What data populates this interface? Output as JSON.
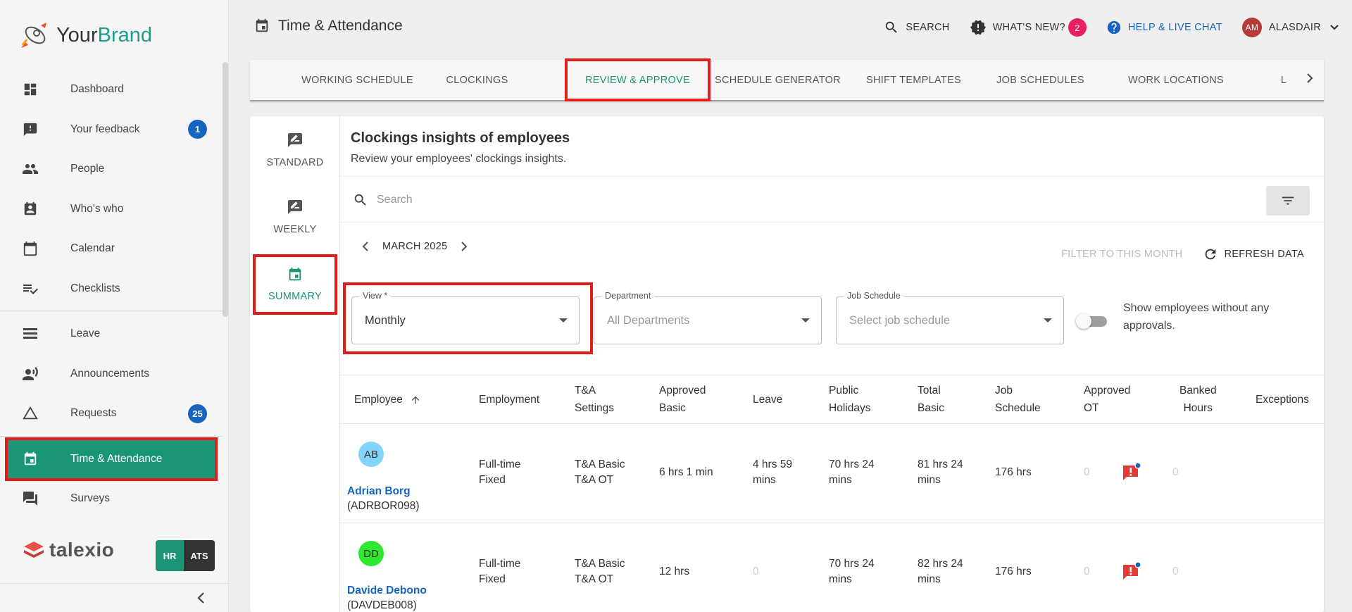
{
  "brand": {
    "name_part1": "Your",
    "name_part2": "Brand",
    "accent_color": "#1a9e8f"
  },
  "sidebar": {
    "items": [
      {
        "label": "Dashboard",
        "icon": "dashboard-icon"
      },
      {
        "label": "Your feedback",
        "icon": "feedback-icon",
        "badge": "1"
      },
      {
        "label": "People",
        "icon": "people-icon"
      },
      {
        "label": "Who's who",
        "icon": "contact-card-icon"
      },
      {
        "label": "Calendar",
        "icon": "calendar-icon"
      },
      {
        "label": "Checklists",
        "icon": "checklist-icon"
      },
      {
        "label": "Leave",
        "icon": "leave-icon"
      },
      {
        "label": "Announcements",
        "icon": "announcement-icon"
      },
      {
        "label": "Requests",
        "icon": "requests-icon",
        "badge": "25"
      },
      {
        "label": "Time & Attendance",
        "icon": "time-attendance-icon",
        "active": true
      },
      {
        "label": "Surveys",
        "icon": "surveys-icon"
      }
    ],
    "footer_logo": "talexio",
    "hr_label": "HR",
    "ats_label": "ATS"
  },
  "header": {
    "title": "Time & Attendance",
    "search_label": "SEARCH",
    "whats_new_label": "WHAT'S NEW?",
    "whats_new_count": "2",
    "help_label": "HELP & LIVE CHAT",
    "user_initials": "AM",
    "user_name": "ALASDAIR"
  },
  "tabs": [
    {
      "label": "WORKING SCHEDULE"
    },
    {
      "label": "CLOCKINGS"
    },
    {
      "label": "REVIEW & APPROVE",
      "active": true
    },
    {
      "label": "SCHEDULE GENERATOR"
    },
    {
      "label": "SHIFT TEMPLATES"
    },
    {
      "label": "JOB SCHEDULES"
    },
    {
      "label": "WORK LOCATIONS"
    },
    {
      "label": "L"
    }
  ],
  "view_tabs": [
    {
      "label": "STANDARD"
    },
    {
      "label": "WEEKLY"
    },
    {
      "label": "SUMMARY",
      "active": true
    }
  ],
  "main": {
    "title": "Clockings insights of employees",
    "subtitle": "Review your employees' clockings insights.",
    "search_placeholder": "Search",
    "month": "MARCH 2025",
    "filter_month_label": "FILTER TO THIS MONTH",
    "refresh_label": "REFRESH DATA",
    "fields": {
      "view": {
        "label": "View *",
        "value": "Monthly"
      },
      "department": {
        "label": "Department",
        "placeholder": "All Departments"
      },
      "job_schedule": {
        "label": "Job Schedule",
        "placeholder": "Select job schedule"
      }
    },
    "toggle_label": "Show employees without any approvals.",
    "table": {
      "headers": {
        "employee": "Employee",
        "employment": "Employment",
        "ta_settings_1": "T&A",
        "ta_settings_2": "Settings",
        "approved_basic_1": "Approved",
        "approved_basic_2": "Basic",
        "leave": "Leave",
        "public_holidays_1": "Public",
        "public_holidays_2": "Holidays",
        "total_basic_1": "Total",
        "total_basic_2": "Basic",
        "job_schedule_1": "Job",
        "job_schedule_2": "Schedule",
        "approved_ot_1": "Approved",
        "approved_ot_2": "OT",
        "banked_hours_1": "Banked",
        "banked_hours_2": "Hours",
        "exceptions": "Exceptions"
      },
      "rows": [
        {
          "initials": "AB",
          "avatar_color": "#81d4fa",
          "name": "Adrian Borg",
          "code": "(ADRBOR098)",
          "employment_1": "Full-time",
          "employment_2": "Fixed",
          "ta_1": "T&A Basic",
          "ta_2": "T&A OT",
          "approved_basic": "6 hrs 1 min",
          "leave_1": "4 hrs 59",
          "leave_2": "mins",
          "public_holidays_1": "70 hrs 24",
          "public_holidays_2": "mins",
          "total_basic_1": "81 hrs 24",
          "total_basic_2": "mins",
          "job_schedule": "176 hrs",
          "approved_ot": "0",
          "banked_hours": "0"
        },
        {
          "initials": "DD",
          "avatar_color": "#2ee82e",
          "name": "Davide Debono",
          "code": "(DAVDEB008)",
          "employment_1": "Full-time",
          "employment_2": "Fixed",
          "ta_1": "T&A Basic",
          "ta_2": "T&A OT",
          "approved_basic": "12 hrs",
          "leave": "0",
          "public_holidays_1": "70 hrs 24",
          "public_holidays_2": "mins",
          "total_basic_1": "82 hrs 24",
          "total_basic_2": "mins",
          "job_schedule": "176 hrs",
          "approved_ot": "0",
          "banked_hours": "0"
        }
      ]
    }
  }
}
